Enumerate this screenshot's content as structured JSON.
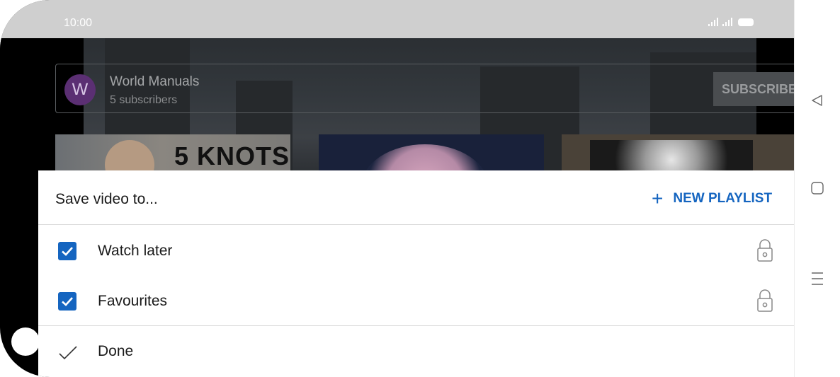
{
  "status_bar": {
    "time": "10:00",
    "icons": [
      "signal-icon",
      "signal-icon",
      "battery-icon"
    ]
  },
  "channel": {
    "avatar_letter": "W",
    "name": "World Manuals",
    "subscribers": "5 subscribers",
    "subscribe_label": "SUBSCRIBE"
  },
  "thumbnails": [
    {
      "text": "5 KNOTS"
    },
    {
      "text": ""
    },
    {
      "text": ""
    }
  ],
  "save_sheet": {
    "title": "Save video to...",
    "new_playlist_label": "NEW PLAYLIST",
    "playlists": [
      {
        "label": "Watch later",
        "checked": true,
        "privacy": "private"
      },
      {
        "label": "Favourites",
        "checked": true,
        "privacy": "private"
      }
    ],
    "done_label": "Done"
  },
  "nav_bar": {
    "buttons": [
      "back-icon",
      "home-icon",
      "menu-icon"
    ]
  },
  "colors": {
    "accent": "#1565c0",
    "status_bar": "#cfcfcf",
    "avatar": "#5b2f73"
  }
}
